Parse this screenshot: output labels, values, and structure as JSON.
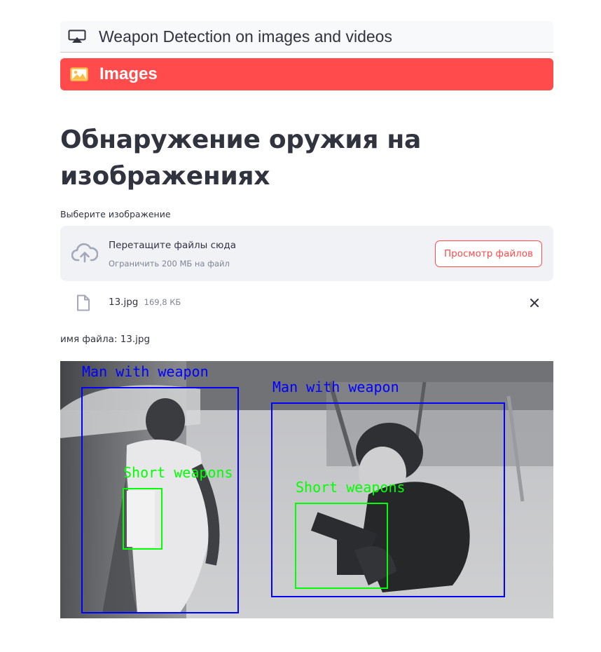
{
  "nav": {
    "top": {
      "label": "Weapon Detection on images and videos",
      "icon": "airplay-icon"
    },
    "selected": {
      "label": "Images",
      "icon": "image-icon",
      "color": "#ff4b4b"
    }
  },
  "page": {
    "title": "Обнаружение оружия на изображениях"
  },
  "uploader": {
    "label": "Выберите изображение",
    "drop_text": "Перетащите файлы сюда",
    "limit_text": "Ограничить 200 МБ на файл",
    "browse_button": "Просмотр файлов"
  },
  "uploaded_file": {
    "name": "13.jpg",
    "size": "169,8 КБ"
  },
  "filename_line": "имя файла: 13.jpg",
  "detections": {
    "man_label_1": "Man with weapon",
    "man_label_2": "Man with weapon",
    "weapon_label_1": "Short weapons",
    "weapon_label_2": "Short weapons",
    "person_box_color": "#0000ff",
    "weapon_box_color": "#00ff00"
  }
}
